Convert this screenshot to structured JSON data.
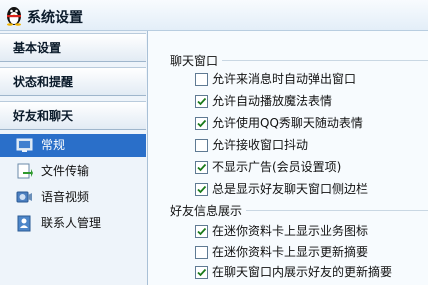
{
  "window": {
    "title": "系统设置"
  },
  "sidebar": {
    "sections": [
      {
        "label": "基本设置"
      },
      {
        "label": "状态和提醒"
      },
      {
        "label": "好友和聊天"
      }
    ],
    "items": [
      {
        "label": "常规",
        "icon": "general-settings-icon",
        "selected": true
      },
      {
        "label": "文件传输",
        "icon": "file-transfer-icon"
      },
      {
        "label": "语音视频",
        "icon": "voice-video-icon"
      },
      {
        "label": "联系人管理",
        "icon": "contact-management-icon"
      }
    ]
  },
  "chat_window": {
    "heading": "聊天窗口",
    "options": [
      {
        "label": "允许来消息时自动弹出窗口",
        "checked": false
      },
      {
        "label": "允许自动播放魔法表情",
        "checked": true
      },
      {
        "label": "允许使用QQ秀聊天随动表情",
        "checked": true
      },
      {
        "label": "允许接收窗口抖动",
        "checked": false
      },
      {
        "label": "不显示广告(会员设置项)",
        "checked": true
      },
      {
        "label": "总是显示好友聊天窗口侧边栏",
        "checked": true
      }
    ]
  },
  "friend_info": {
    "heading": "好友信息展示",
    "options": [
      {
        "label": "在迷你资料卡上显示业务图标",
        "checked": true
      },
      {
        "label": "在迷你资料卡上显示更新摘要",
        "checked": false
      },
      {
        "label": "在聊天窗口内展示好友的更新摘要",
        "checked": true
      }
    ]
  },
  "colors": {
    "accent": "#2a6fc9",
    "check": "#1a7a1a"
  }
}
